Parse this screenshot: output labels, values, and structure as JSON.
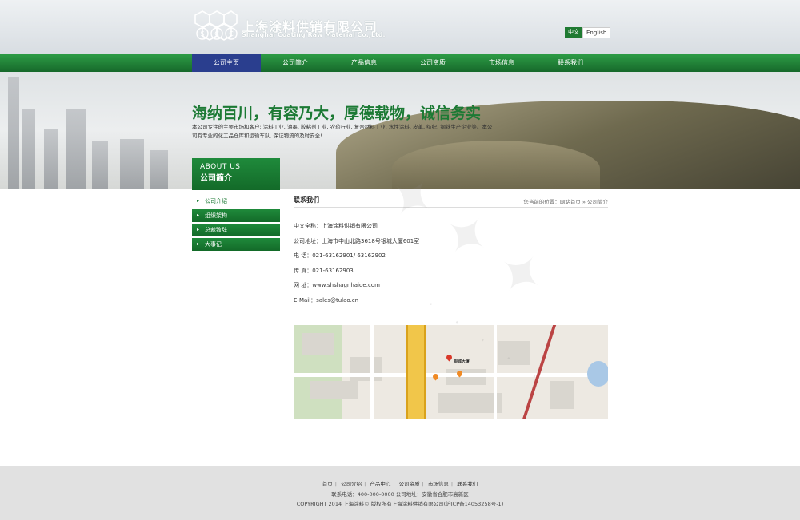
{
  "header": {
    "company_cn": "上海涂料供销有限公司",
    "company_en": "Shanghai Coating Raw Material Co.,Ltd.",
    "logo_letters": [
      "S",
      "C",
      "C"
    ],
    "lang": {
      "cn": "中文",
      "en": "English"
    }
  },
  "nav": {
    "items": [
      "公司主页",
      "公司简介",
      "产品信息",
      "公司资质",
      "市场信息",
      "联系我们"
    ]
  },
  "banner": {
    "slogan": "海纳百川，有容乃大，厚德载物，诚信务实",
    "intro": "本公司专注的主要市场和客户: 涂料工业, 油墨, 胶粘剂工业, 农药行业, 复合材料工业, 水性涂料, 皮革, 纺织, 钢铁生产企业等。本公司有专业的化工品仓库和运输车队, 保证物流的及时安全!"
  },
  "about": {
    "en": "ABOUT US",
    "cn": "公司简介"
  },
  "sidebar": {
    "items": [
      "公司介绍",
      "组织架构",
      "总裁致辞",
      "大事记"
    ]
  },
  "main": {
    "title": "联系我们",
    "breadcrumb": "您当前的位置：网站首页 » 公司简介",
    "contact": [
      "中文全称：上海涂料供销有限公司",
      "公司地址：上海市中山北路3618号银城大厦601室",
      "电 话：021-63162901/ 63162902",
      "传 真：021-63162903",
      "网 址：www.shshagnhaide.com",
      "E-Mail：sales@tulao.cn"
    ],
    "map_label": "银城大厦"
  },
  "footer": {
    "links": [
      "首页",
      "公司介绍",
      "产品中心",
      "公司资质",
      "市场信息",
      "联系我们"
    ],
    "line1": "联系电话：400-000-0000  公司地址：安徽省合肥市高新区",
    "line2": "COPYRIGHT 2014 上海涂料© 版权所有上海涂料供销有限公司(沪ICP备14053258号-1)"
  },
  "colors": {
    "green": "#1c7a34",
    "nav_active": "#2a3e8e"
  }
}
